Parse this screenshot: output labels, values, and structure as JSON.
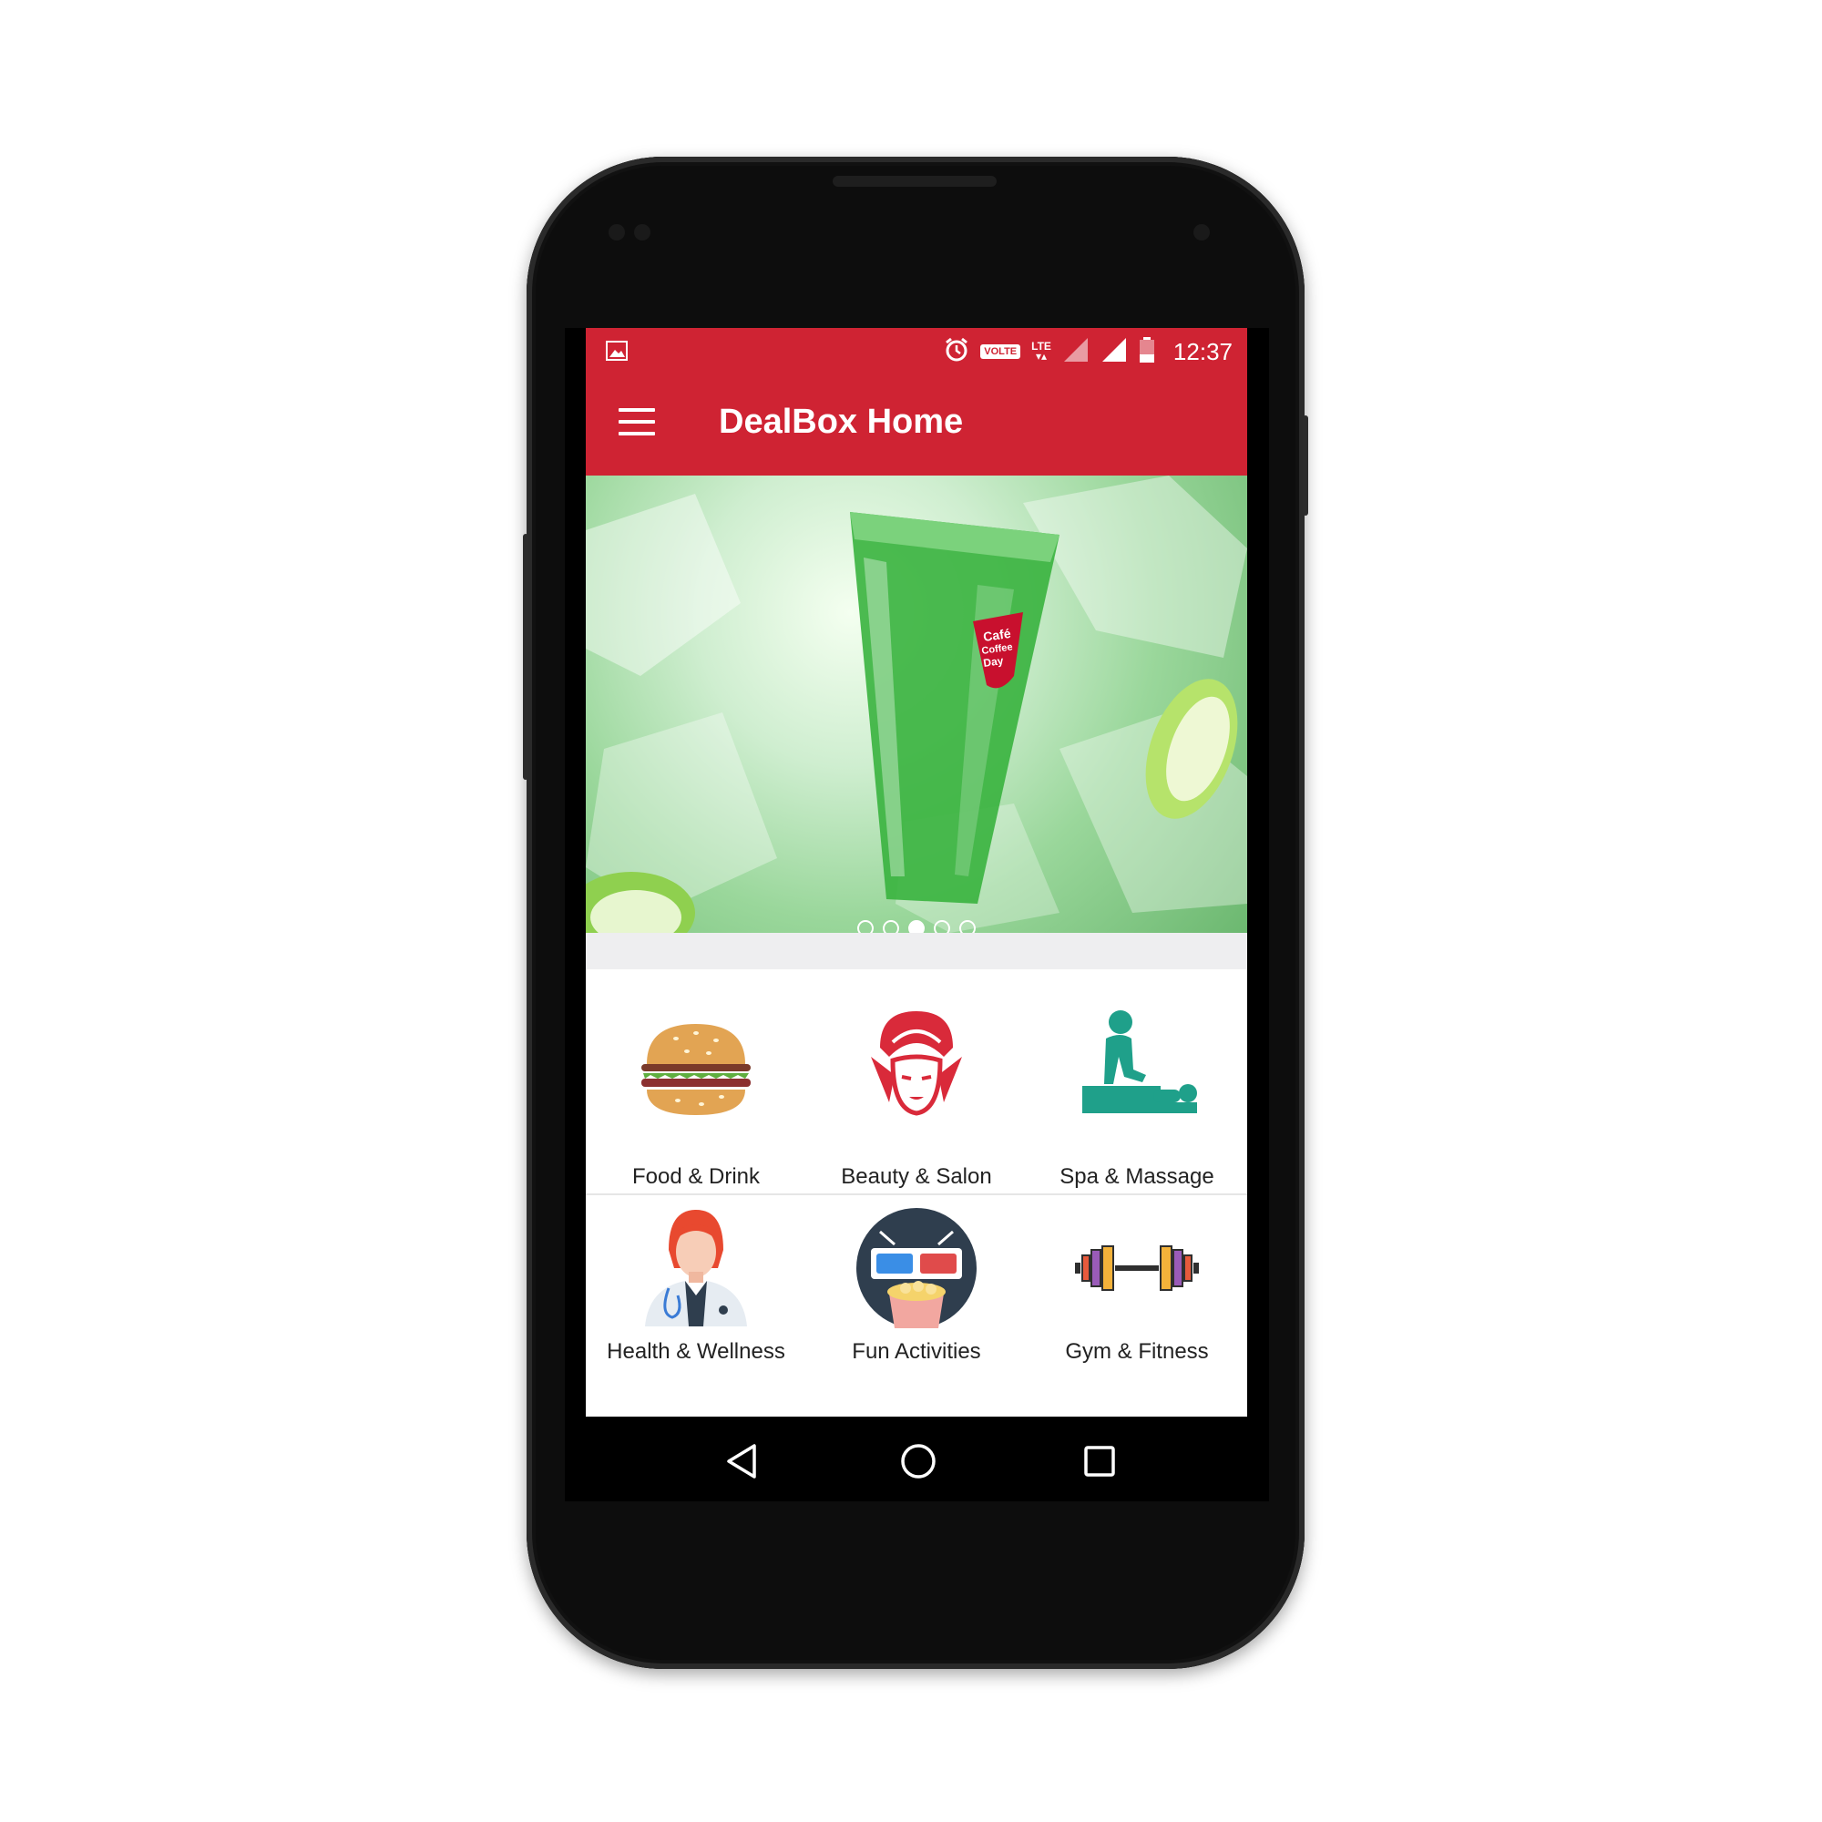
{
  "status_bar": {
    "volte_label": "VOLTE",
    "lte_label": "LTE",
    "time": "12:37"
  },
  "toolbar": {
    "title": "DealBox Home"
  },
  "banner": {
    "slide_count": 5,
    "active_slide": 3,
    "brand_text": [
      "Café",
      "Coffee",
      "Day"
    ]
  },
  "categories": [
    {
      "label": "Food & Drink",
      "icon": "burger-icon"
    },
    {
      "label": "Beauty & Salon",
      "icon": "woman-face-icon"
    },
    {
      "label": "Spa & Massage",
      "icon": "massage-icon"
    },
    {
      "label": "Health & Wellness",
      "icon": "doctor-icon"
    },
    {
      "label": "Fun Activities",
      "icon": "3d-glasses-popcorn-icon"
    },
    {
      "label": "Gym & Fitness",
      "icon": "dumbbell-icon"
    }
  ],
  "colors": {
    "primary": "#cf2333",
    "teal": "#1fa08a"
  }
}
